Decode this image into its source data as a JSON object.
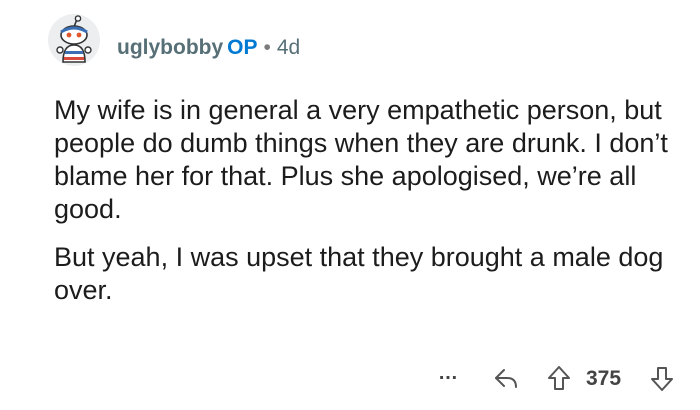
{
  "comment": {
    "username": "uglybobby",
    "op_badge": "OP",
    "separator": "•",
    "age": "4d",
    "paragraphs": [
      "My wife is in general a very empathetic person, but people do dumb things when they are drunk. I don’t blame her for that. Plus she apologised, we’re all good.",
      "But yeah, I was upset that they brought a male dog over."
    ]
  },
  "actions": {
    "more_label": "…",
    "score": "375"
  },
  "icons": {
    "avatar": "snoo-avatar-icon",
    "reply": "reply-arrow-icon",
    "upvote": "upvote-arrow-icon",
    "downvote": "downvote-arrow-icon"
  }
}
